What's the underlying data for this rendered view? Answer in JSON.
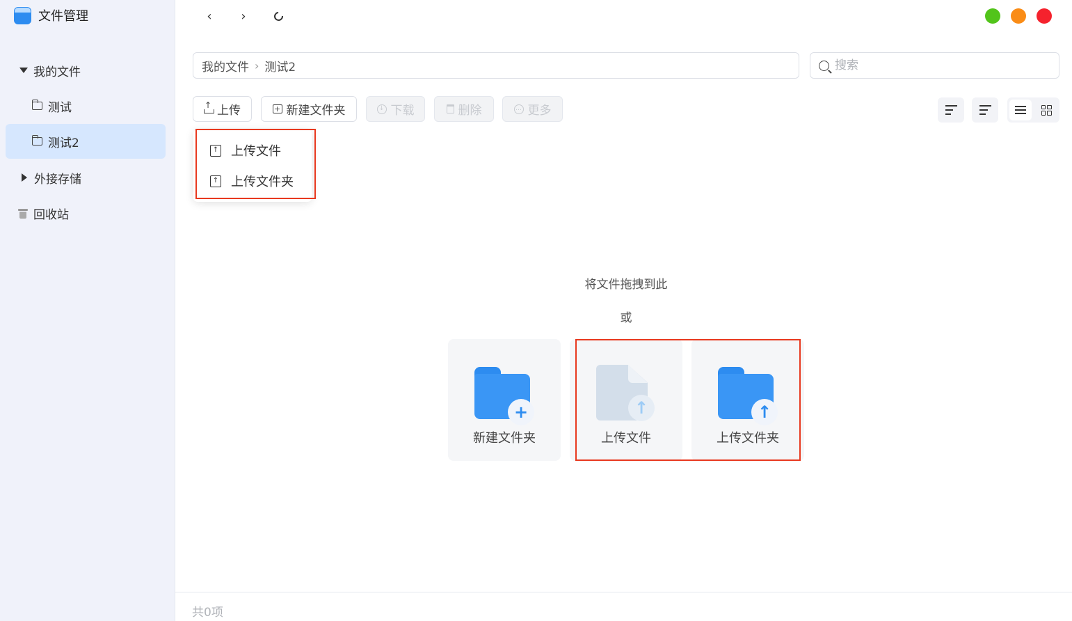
{
  "app": {
    "title": "文件管理"
  },
  "sidebar": {
    "my_files": "我的文件",
    "folders": [
      "测试",
      "测试2"
    ],
    "external": "外接存储",
    "trash": "回收站"
  },
  "nav": {
    "back": "‹",
    "forward": "›"
  },
  "window_dots": [
    "#52c41a",
    "#fa8c16",
    "#f5222d"
  ],
  "breadcrumb": [
    "我的文件",
    "测试2"
  ],
  "search": {
    "placeholder": "搜索",
    "value": ""
  },
  "toolbar": {
    "upload": "上传",
    "new_folder": "新建文件夹",
    "download": "下载",
    "delete": "删除",
    "more": "更多"
  },
  "upload_menu": {
    "upload_file": "上传文件",
    "upload_folder": "上传文件夹"
  },
  "empty": {
    "drag_hint": "将文件拖拽到此",
    "or": "或",
    "new_folder": "新建文件夹",
    "upload_file": "上传文件",
    "upload_folder": "上传文件夹"
  },
  "footer": {
    "count": "共0项"
  },
  "accent_color": "#2d8cf0",
  "highlight_color": "#e8391f"
}
